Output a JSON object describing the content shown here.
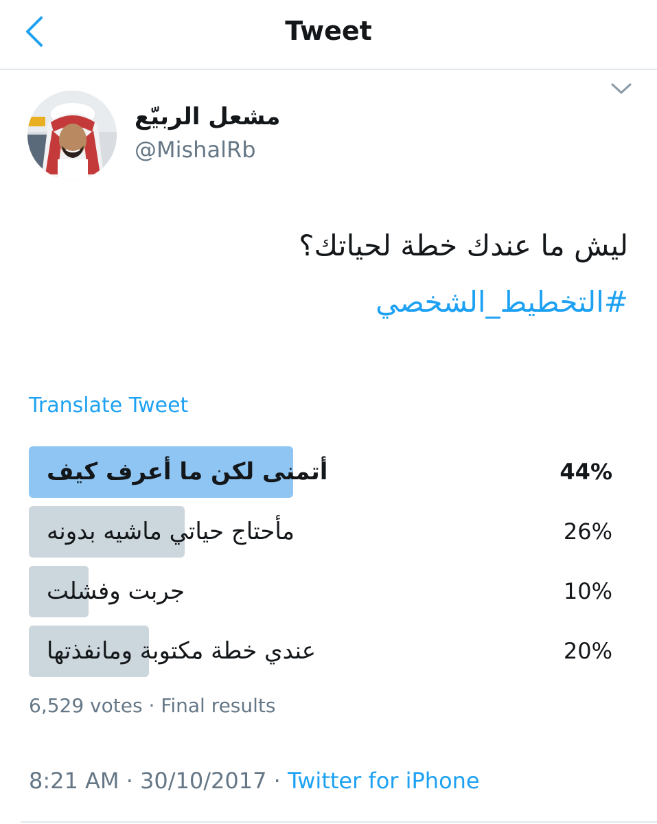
{
  "header": {
    "title": "Tweet"
  },
  "icons": {
    "back": "chevron-left-icon",
    "menu": "chevron-down-icon"
  },
  "colors": {
    "accent": "#1da1f2",
    "winner_bar": "#8ec5f2",
    "bar": "#ccd6dd",
    "secondary_text": "#657786"
  },
  "author": {
    "display_name": "مشعل الربيّع",
    "handle": "@MishalRb"
  },
  "tweet": {
    "text": "ليش ما عندك خطة لحياتك؟",
    "hashtag": "#التخطيط_الشخصي",
    "translate_label": "Translate Tweet"
  },
  "poll": {
    "options": [
      {
        "label": "أتمنى لكن ما أعرف كيف",
        "percent_label": "44%",
        "percent": 44,
        "winner": true
      },
      {
        "label": "مأحتاج حياتي ماشيه بدونه",
        "percent_label": "26%",
        "percent": 26,
        "winner": false
      },
      {
        "label": "جربت وفشلت",
        "percent_label": "10%",
        "percent": 10,
        "winner": false
      },
      {
        "label": "عندي خطة مكتوبة ومانفذتها",
        "percent_label": "20%",
        "percent": 20,
        "winner": false
      }
    ],
    "summary": "6,529 votes · Final results"
  },
  "meta": {
    "time": "8:21 AM",
    "separator": "·",
    "date": "30/10/2017",
    "source": "Twitter for iPhone"
  }
}
